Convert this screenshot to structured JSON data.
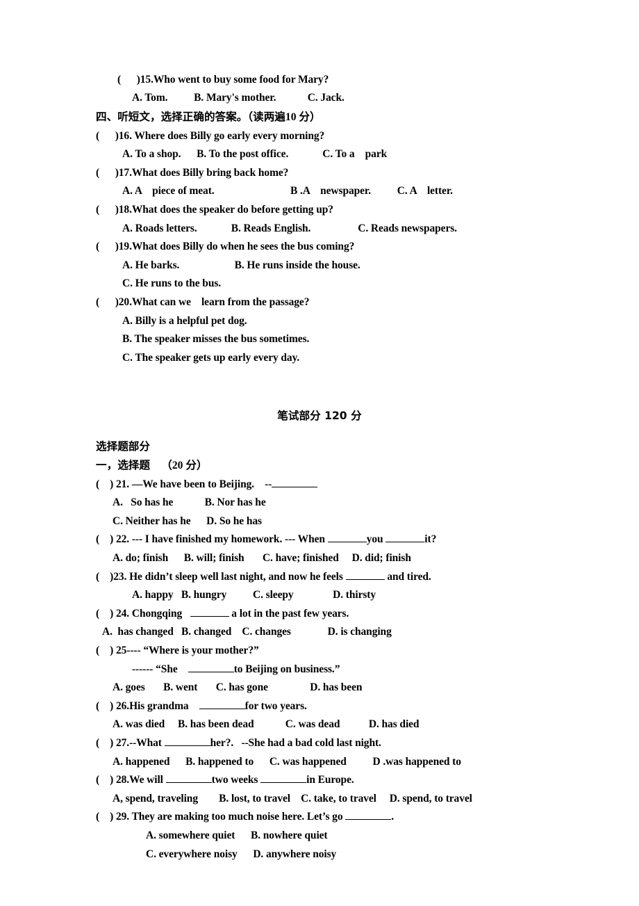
{
  "document": {
    "type": "english-exam-paper",
    "listening_section": {
      "question_15": {
        "prompt": "(      )15.Who went to buy some food for Mary?",
        "options": "A. Tom.          B. Mary's mother.            C. Jack."
      },
      "section_heading": "四、听短文，选择正确的答案。（读两遍",
      "section_heading_score": "10 分）",
      "question_16": {
        "prompt": "(      )16. Where does Billy go early every morning?",
        "options": "A. To a shop.      B. To the post office.             C. To a    park"
      },
      "question_17": {
        "prompt": "(      )17.What does Billy bring back home?",
        "options": "A. A    piece of meat.                             B .A    newspaper.          C. A    letter."
      },
      "question_18": {
        "prompt": "(      )18.What does the speaker do before getting up?",
        "options": "A. Roads letters.             B. Reads English.                  C. Reads newspapers."
      },
      "question_19": {
        "prompt": "(      )19.What does Billy do when he sees the bus coming?",
        "options_line1": "A. He barks.                     B. He runs inside the house.",
        "options_line2": "C. He runs to the bus."
      },
      "question_20": {
        "prompt": "(      )20.What can we    learn from the passage?",
        "option_a": "A. Billy is a helpful pet dog.",
        "option_b": "B. The speaker misses the bus sometimes.",
        "option_c": "C. The speaker gets up early every day."
      }
    },
    "written_section": {
      "title": "笔试部分 120 分",
      "subsection_heading": "选择题部分",
      "part_one_heading": "一，选择题   （",
      "part_one_score": "20 分",
      "part_one_heading_tail": "）",
      "question_21": {
        "prompt_pre": "(    ) 21. —We have been to Beijing.    --",
        "options_line1": "A.   So has he            B. Nor has he",
        "options_line2": "C. Neither has he      D. So he has"
      },
      "question_22": {
        "prompt_pre": "(    ) 22. --- I have finished my homework. --- When ",
        "prompt_mid": "you ",
        "prompt_post": "it?",
        "options": "A. do; finish      B. will; finish       C. have; finished     D. did; finish"
      },
      "question_23": {
        "prompt_pre": "(    )23. He didn’t sleep well last night, and now he feels ",
        "prompt_post": " and tired.",
        "options": "A. happy   B. hungry          C. sleepy               D. thirsty"
      },
      "question_24": {
        "prompt_pre": "(    ) 24. Chongqing   ",
        "prompt_post": " a lot in the past few years.",
        "options": "A.  has changed   B. changed    C. changes              D. is changing"
      },
      "question_25": {
        "prompt": "(    ) 25---- “Where is your mother?”",
        "prompt_line2_pre": "------ “She    ",
        "prompt_line2_post": "to Beijing on business.”",
        "options": "A. goes       B. went       C. has gone                D. has been"
      },
      "question_26": {
        "prompt_pre": "(    ) 26.His grandma    ",
        "prompt_post": "for two years.",
        "options": "A. was died     B. has been dead            C. was dead           D. has died"
      },
      "question_27": {
        "prompt_pre": "(    ) 27.--What ",
        "prompt_post": "her?.   --She had a bad cold last night.",
        "options": "A. happened      B. happened to      C. was happened          D .was happened to"
      },
      "question_28": {
        "prompt_pre": "(    ) 28.We will ",
        "prompt_mid": "two weeks ",
        "prompt_post": "in Europe.",
        "options": "A, spend, traveling        B. lost, to travel    C. take, to travel     D. spend, to travel"
      },
      "question_29": {
        "prompt_pre": "(    ) 29. They are making too much noise here. Let’s go ",
        "prompt_post": ".",
        "options_line1": "A. somewhere quiet      B. nowhere quiet",
        "options_line2": "C. everywhere noisy      D. anywhere noisy"
      }
    }
  }
}
